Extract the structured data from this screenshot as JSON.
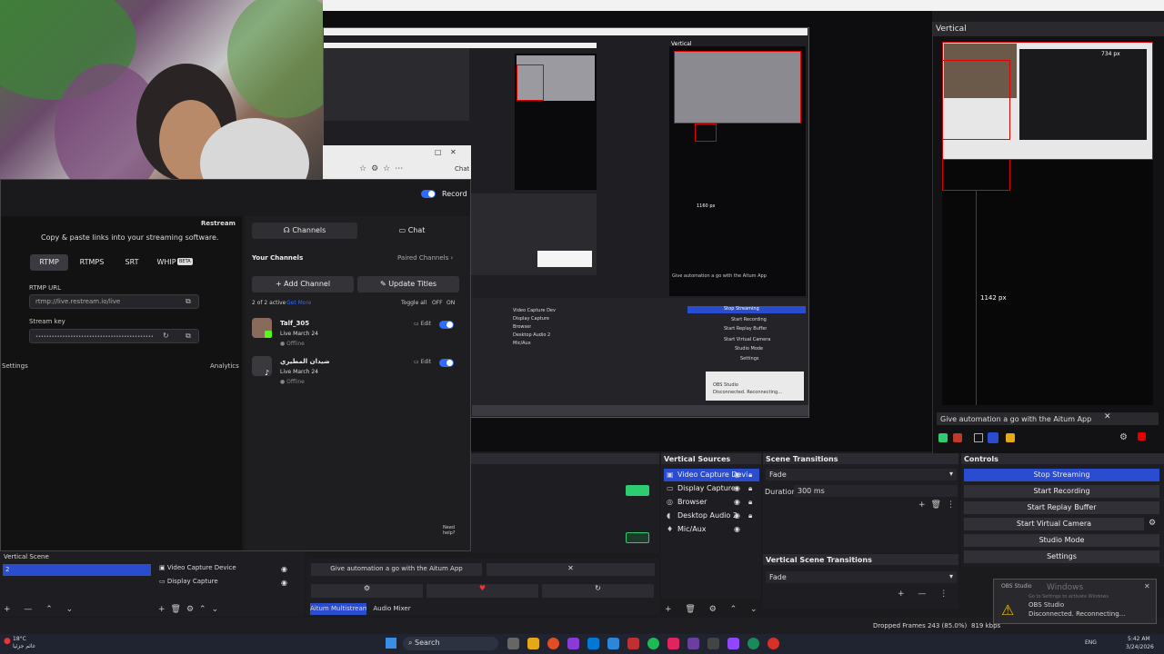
{
  "vertical_panel": {
    "title": "Vertical",
    "automation_text": "Give automation a go with the Aitum App",
    "close": "✕",
    "measure_top": "734 px",
    "measure_side": "1142 px"
  },
  "restream": {
    "brand": "Restream",
    "record_label": "Record",
    "subtitle": "Copy & paste links into your streaming software.",
    "protocols": [
      "RTMP",
      "RTMPS",
      "SRT",
      "WHIP"
    ],
    "whip_badge": "BETA",
    "rtmp_url_label": "RTMP URL",
    "rtmp_url_value": "rtmp://live.restream.io/live",
    "stream_key_label": "Stream key",
    "stream_key_value": "••••••••••••••••••••••••••••••••••••••••••••",
    "settings_label": "Settings",
    "analytics_label": "Analytics",
    "tab_channels": "Channels",
    "tab_chat": "Chat",
    "your_channels": "Your Channels",
    "paired_channels": "Paired Channels",
    "add_channel": "+ Add Channel",
    "update_titles": "Update Titles",
    "active_count": "2 of 2 active",
    "get_more": "Get More",
    "toggle_all": "Toggle all",
    "off": "OFF",
    "on": "ON",
    "edit": "Edit",
    "need_help": "Need help?",
    "browser_chat": "Chat",
    "channels": [
      {
        "name": "Talf_305",
        "date": "Live March 24",
        "status": "Offline"
      },
      {
        "name": "ضيدان المطيري",
        "date": "Live March 24",
        "status": "Offline"
      }
    ]
  },
  "nested": {
    "vertical": "Vertical",
    "px_label": "1160 px",
    "automation": "Give automation a go with the Aitum App",
    "controls": [
      "Stop Streaming",
      "Start Recording",
      "Start Replay Buffer",
      "Start Virtual Camera",
      "Studio Mode",
      "Settings"
    ],
    "sources": [
      "Video Capture Dev",
      "Display Capture",
      "Browser",
      "Desktop Audio 2",
      "Mic/Aux"
    ],
    "notif_title": "OBS Studio",
    "notif_text": "Disconnected. Reconnecting..."
  },
  "obs": {
    "vertical_sources_title": "Vertical Sources",
    "vertical_sources": [
      "Video Capture Devi",
      "Display Capture",
      "Browser",
      "Desktop Audio 2",
      "Mic/Aux"
    ],
    "scene_transitions_title": "Scene Transitions",
    "transition_value": "Fade",
    "duration_label": "Duration",
    "duration_value": "300 ms",
    "vertical_scene_transitions_title": "Vertical Scene Transitions",
    "vertical_transition_value": "Fade",
    "controls_title": "Controls",
    "controls": [
      "Stop Streaming",
      "Start Recording",
      "Start Replay Buffer",
      "Start Virtual Camera",
      "Studio Mode",
      "Settings"
    ],
    "vertical_scene_label": "Vertical Scene",
    "scene_item": "2",
    "scene_sources": [
      "Video Capture Device",
      "Display Capture"
    ],
    "automation_text": "Give automation a go with the Aitum App",
    "tab_multistream": "Aitum Multistream",
    "tab_audio_mixer": "Audio Mixer",
    "status_dropped": "Dropped Frames 243 (85.0%)",
    "status_kbps": "819 kbps",
    "notif_title": "OBS Studio",
    "notif_text": "Disconnected. Reconnecting...",
    "notif_bg": "Windows",
    "notif_bg2": "Go to Settings to activate Windows"
  },
  "taskbar": {
    "weather_temp": "18°C",
    "weather_desc": "غائم جزئيا",
    "search": "Search",
    "lang": "ENG",
    "time": "5:42 AM",
    "date": "3/24/2026"
  },
  "colors": {
    "accent": "#2f6bff",
    "obs_blue": "#2a4ccf",
    "red": "#e00000",
    "green": "#2ecc71"
  }
}
